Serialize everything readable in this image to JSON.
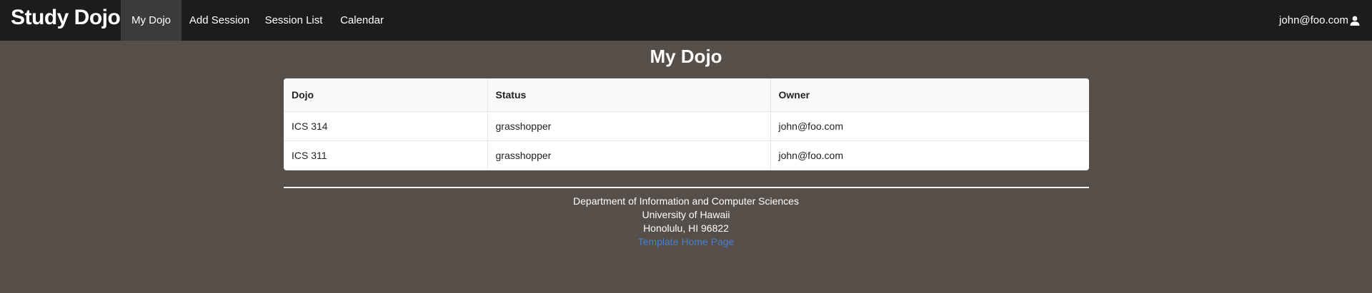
{
  "navbar": {
    "brand": "Study Dojo",
    "items": [
      {
        "label": "My Dojo",
        "active": true
      },
      {
        "label": "Add Session",
        "active": false
      },
      {
        "label": "Session List",
        "active": false
      },
      {
        "label": "Calendar",
        "active": false
      }
    ],
    "user": {
      "email": "john@foo.com",
      "icon": "user-icon"
    }
  },
  "page": {
    "title": "My Dojo"
  },
  "table": {
    "headers": [
      "Dojo",
      "Status",
      "Owner"
    ],
    "rows": [
      [
        "ICS 314",
        "grasshopper",
        "john@foo.com"
      ],
      [
        "ICS 311",
        "grasshopper",
        "john@foo.com"
      ]
    ]
  },
  "footer": {
    "lines": [
      "Department of Information and Computer Sciences",
      "University of Hawaii",
      "Honolulu, HI 96822"
    ],
    "link": "Template Home Page"
  },
  "colors": {
    "background": "#564e48",
    "navbar": "#1b1c1e",
    "nav_active": "#3a3b3d",
    "link": "#4a7fcf"
  }
}
